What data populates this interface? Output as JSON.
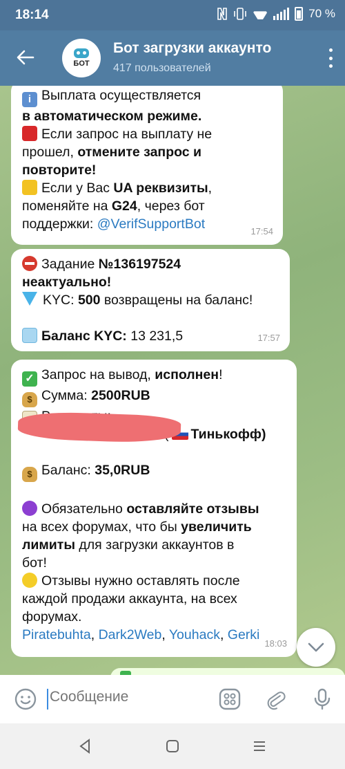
{
  "status_bar": {
    "time": "18:14",
    "battery": "70 %"
  },
  "header": {
    "title": "Бот загрузки аккаунто",
    "subtitle": "417 пользователей",
    "avatar_text": "БОТ"
  },
  "messages": [
    {
      "lines": [
        [
          {
            "t": "Выплата осуществляется",
            "b": false
          }
        ],
        [
          {
            "t": "в автоматическом режиме.",
            "b": true
          }
        ],
        [
          {
            "t": "Если запрос на выплату не",
            "b": false
          }
        ],
        [
          {
            "t": "прошел, ",
            "b": false
          },
          {
            "t": "отмените запрос и",
            "b": true
          }
        ],
        [
          {
            "t": "повторите!",
            "b": true
          }
        ],
        [
          {
            "t": "Если у Вас ",
            "b": false
          },
          {
            "t": "UA реквизиты",
            "b": true
          },
          {
            "t": ",",
            "b": false
          }
        ],
        [
          {
            "t": "поменяйте на ",
            "b": false
          },
          {
            "t": "G24",
            "b": true
          },
          {
            "t": ", через бот",
            "b": false
          }
        ],
        [
          {
            "t": "поддержки: ",
            "b": false
          },
          {
            "t": "@VerifSupportBot",
            "link": true
          }
        ]
      ],
      "time": "17:54"
    },
    {
      "lines": [
        [
          {
            "t": "Задание ",
            "b": false
          },
          {
            "t": "№136197524",
            "b": true
          }
        ],
        [
          {
            "t": "неактуально!",
            "b": true
          }
        ],
        [
          {
            "t": "KYC: ",
            "b": false
          },
          {
            "t": "500",
            "b": true
          },
          {
            "t": " возвращены на баланс!",
            "b": false
          }
        ],
        [],
        [
          {
            "t": "Баланс KYC: ",
            "b": true
          },
          {
            "t": "13 231,5",
            "b": false
          }
        ]
      ],
      "time": "17:57"
    },
    {
      "lines": [
        [
          {
            "t": "Запрос на вывод",
            "b": false
          },
          {
            "t": ", ",
            "b": false
          },
          {
            "t": "исполнен",
            "b": true
          },
          {
            "t": "!",
            "b": false
          }
        ],
        [
          {
            "t": "Сумма: ",
            "b": false
          },
          {
            "t": "2500RUB",
            "b": true
          }
        ],
        [
          {
            "t": "Реквизиты:",
            "b": false
          }
        ],
        [
          {
            "t": "Тинькофф)",
            "b": true
          }
        ],
        [],
        [
          {
            "t": "Баланс: ",
            "b": false
          },
          {
            "t": "35,0RUB",
            "b": true
          }
        ],
        [],
        [
          {
            "t": "Обязательно ",
            "b": false
          },
          {
            "t": "оставляйте отзывы",
            "b": true
          }
        ],
        [
          {
            "t": "на всех форумах, что бы ",
            "b": false
          },
          {
            "t": "увеличить",
            "b": true
          }
        ],
        [
          {
            "t": "лимиты",
            "b": true
          },
          {
            "t": " для загрузки аккаунтов в",
            "b": false
          }
        ],
        [
          {
            "t": "бот!",
            "b": false
          }
        ],
        [
          {
            "t": "Отзывы нужно оставлять после",
            "b": false
          }
        ],
        [
          {
            "t": "каждой продажи аккаунта, на всех",
            "b": false
          }
        ],
        [
          {
            "t": "форумах.",
            "b": false
          }
        ],
        [
          {
            "t": "Piratebuhta",
            "link": true
          },
          {
            "t": ", ",
            "b": false
          },
          {
            "t": "Dark2Web",
            "link": true
          },
          {
            "t": ", ",
            "b": false
          },
          {
            "t": "Youhack",
            "link": true
          },
          {
            "t": ", ",
            "b": false
          },
          {
            "t": "Gerki",
            "link": true
          }
        ]
      ],
      "time": "18:03"
    }
  ],
  "input": {
    "placeholder": "Сообщение"
  },
  "icons": [
    "back-arrow-icon",
    "menu-dots-icon",
    "emoji-icon",
    "commands-grid-icon",
    "attach-icon",
    "microphone-icon",
    "chevron-down-icon"
  ]
}
